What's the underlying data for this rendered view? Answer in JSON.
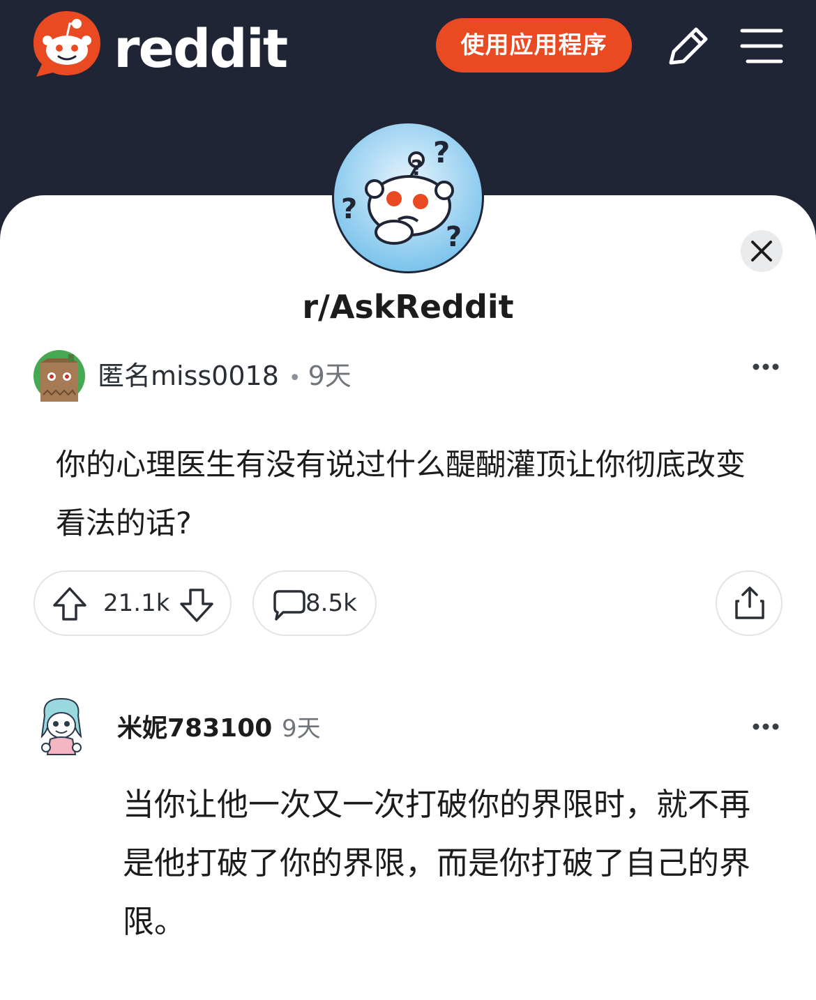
{
  "header": {
    "logo_icon": "reddit-snoo-logo",
    "wordmark": "reddit",
    "app_button": "使用应用程序",
    "edit_icon": "pencil-icon",
    "menu_icon": "hamburger-menu-icon",
    "brand_color": "#ea4a22",
    "bg_color": "#1f2535"
  },
  "subreddit": {
    "avatar_icon": "askreddit-confused-snoo",
    "name": "r/AskReddit"
  },
  "post": {
    "author": "匿名miss0018",
    "separator": "•",
    "time": "9天",
    "title": "你的心理医生有没有说过什么醍醐灌顶让你彻底改变看法的话?",
    "upvotes": "21.1k",
    "comments": "8.5k"
  },
  "comment": {
    "author": "米妮783100",
    "time": "9天",
    "body": "当你让他一次又一次打破你的界限时，就不再是他打破了你的界限，而是你打破了自己的界限。"
  }
}
